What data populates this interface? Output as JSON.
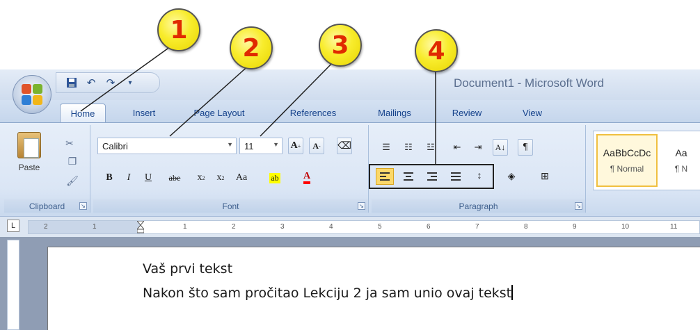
{
  "window": {
    "title": "Document1 - Microsoft Word"
  },
  "quick_access": {
    "save_icon": "save-icon",
    "undo_icon": "undo-icon",
    "redo_icon": "redo-icon",
    "customize_icon": "customize-qat-icon"
  },
  "tabs": [
    {
      "label": "Home",
      "active": true
    },
    {
      "label": "Insert"
    },
    {
      "label": "Page Layout"
    },
    {
      "label": "References"
    },
    {
      "label": "Mailings"
    },
    {
      "label": "Review"
    },
    {
      "label": "View"
    }
  ],
  "ribbon": {
    "clipboard": {
      "label": "Clipboard",
      "paste_label": "Paste"
    },
    "font": {
      "label": "Font",
      "font_name": "Calibri",
      "font_size": "11",
      "grow": "A",
      "shrink": "A",
      "bold": "B",
      "italic": "I",
      "underline": "U",
      "strike": "abe",
      "subscript": "x",
      "superscript": "x",
      "case": "Aa"
    },
    "paragraph": {
      "label": "Paragraph",
      "show_marks": "¶",
      "sort": "A↓"
    },
    "styles": {
      "items": [
        {
          "sample": "AaBbCcDc",
          "name": "¶ Normal"
        },
        {
          "sample": "Aa",
          "name": "¶ N"
        }
      ]
    }
  },
  "callouts": [
    "1",
    "2",
    "3",
    "4"
  ],
  "ruler": {
    "corner": "L",
    "labels": [
      "2",
      "1",
      "1",
      "2",
      "3",
      "4",
      "5",
      "6",
      "7",
      "8",
      "9",
      "10",
      "11"
    ]
  },
  "document": {
    "lines": [
      "Vaš prvi tekst",
      "Nakon što sam pročitao Lekciju 2 ja sam unio ovaj tekst"
    ]
  },
  "colors": {
    "callout_fill": "#f8ec2c",
    "callout_text": "#e02a00",
    "ribbon": "#dbe6f5",
    "tab_text": "#15428b"
  }
}
